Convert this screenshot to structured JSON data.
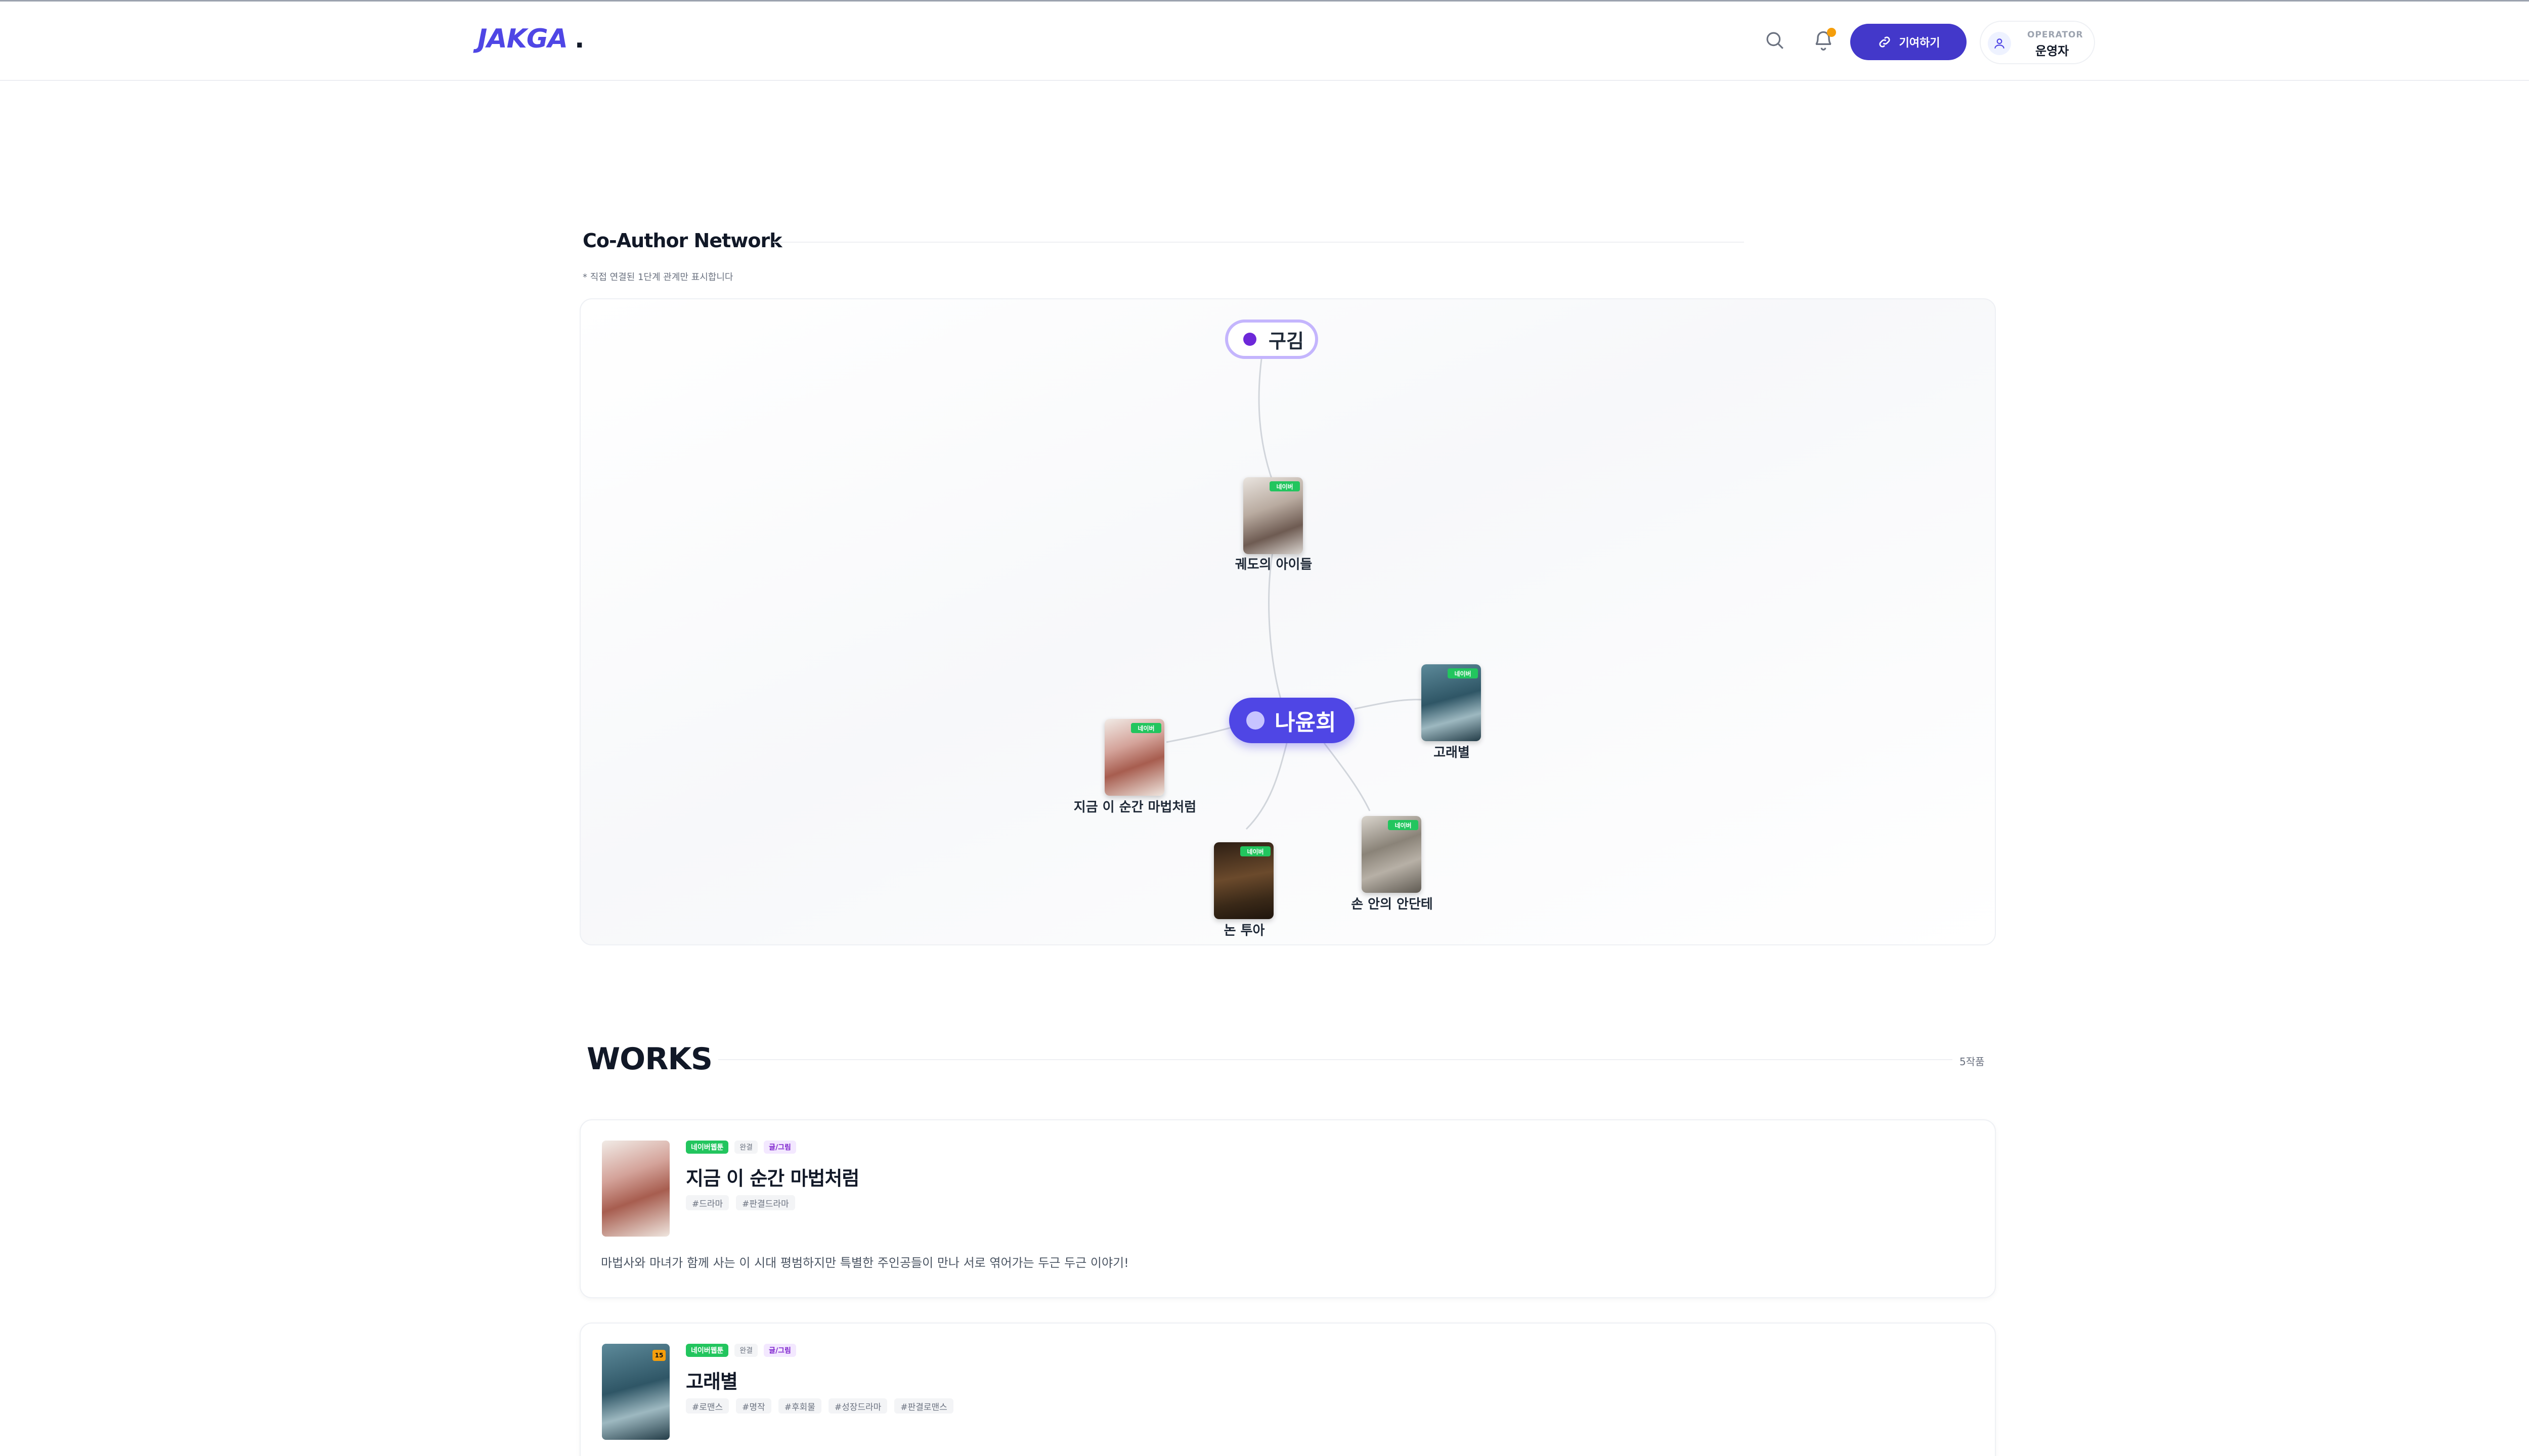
{
  "header": {
    "logo": "JAKGA",
    "logo_dot": ".",
    "contribute_label": "기여하기",
    "user_role": "OPERATOR",
    "user_name": "운영자"
  },
  "network": {
    "title": "Co-Author Network",
    "note": "* 직접 연결된 1단계 관계만 표시합니다",
    "main_author": "나윤희",
    "co_author": "구김",
    "works": [
      {
        "title": "궤도의 아이들",
        "platform": "네이버"
      },
      {
        "title": "고래별",
        "platform": "네이버"
      },
      {
        "title": "지금 이 순간 마법처럼",
        "platform": "네이버"
      },
      {
        "title": "논 투아",
        "platform": "네이버"
      },
      {
        "title": "손 안의 안단테",
        "platform": "네이버"
      }
    ]
  },
  "works_section": {
    "title": "WORKS",
    "count": "5작품",
    "items": [
      {
        "platform": "네이버웹툰",
        "status": "완결",
        "role": "글/그림",
        "title": "지금 이 순간 마법처럼",
        "genres": [
          "#드라마",
          "#판결드라마"
        ],
        "description": "마법사와 마녀가 함께 사는 이 시대 평범하지만 특별한 주인공들이 만나 서로 엮어가는 두근 두근 이야기!"
      },
      {
        "platform": "네이버웹툰",
        "status": "완결",
        "role": "글/그림",
        "age_badge": "15",
        "title": "고래별",
        "genres": [
          "#로맨스",
          "#명작",
          "#후회물",
          "#성장드라마",
          "#판결로맨스"
        ]
      }
    ]
  },
  "colors": {
    "brand": "#4f46e5",
    "button": "#4338ca",
    "platform_badge": "#22c55e",
    "notification": "#f59e0b"
  },
  "icons": [
    "search-icon",
    "bell-icon",
    "link-icon",
    "user-icon"
  ]
}
